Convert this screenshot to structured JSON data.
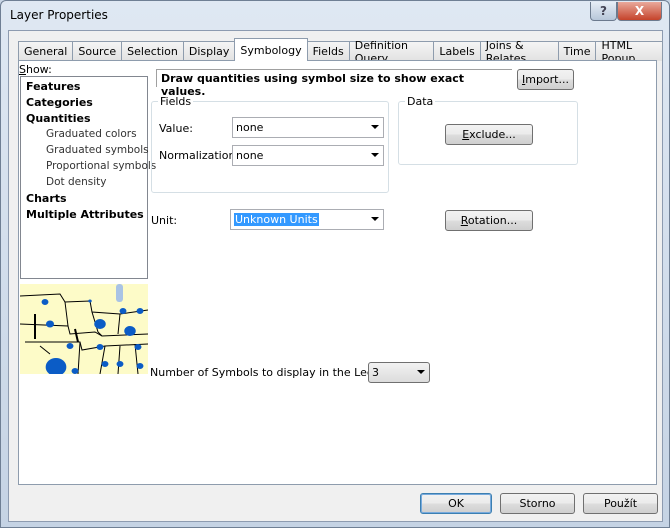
{
  "window": {
    "title": "Layer Properties",
    "help_label": "?",
    "close_label": "X"
  },
  "tabs": [
    {
      "label": "General"
    },
    {
      "label": "Source"
    },
    {
      "label": "Selection"
    },
    {
      "label": "Display"
    },
    {
      "label": "Symbology",
      "active": true
    },
    {
      "label": "Fields"
    },
    {
      "label": "Definition Query"
    },
    {
      "label": "Labels"
    },
    {
      "label": "Joins & Relates"
    },
    {
      "label": "Time"
    },
    {
      "label": "HTML Popup"
    }
  ],
  "show": {
    "label": "Show:",
    "items": [
      {
        "label": "Features",
        "bold": true
      },
      {
        "label": "Categories",
        "bold": true
      },
      {
        "label": "Quantities",
        "bold": true
      },
      {
        "label": "Graduated colors"
      },
      {
        "label": "Graduated symbols"
      },
      {
        "label": "Proportional symbols",
        "selected": true
      },
      {
        "label": "Dot density"
      },
      {
        "label": "Charts",
        "bold": true
      },
      {
        "label": "Multiple Attributes",
        "bold": true
      }
    ]
  },
  "description": "Draw quantities using symbol size to show exact values.",
  "import_label": "Import...",
  "fields": {
    "label": "Fields",
    "value_label": "Value:",
    "value": "none",
    "normalization_label": "Normalization:",
    "normalization": "none"
  },
  "data_group": {
    "label": "Data",
    "exclude_label": "Exclude..."
  },
  "unit": {
    "label": "Unit:",
    "value": "Unknown Units"
  },
  "rotation_label": "Rotation...",
  "legend": {
    "label": "Number of Symbols to display in the Legend:",
    "value": "3"
  },
  "footer": {
    "ok": "OK",
    "cancel": "Storno",
    "apply": "Použít"
  },
  "colors": {
    "map_fill": "#fdfbc8",
    "symbol": "#0b5cc6",
    "selection": "#3399ff"
  }
}
